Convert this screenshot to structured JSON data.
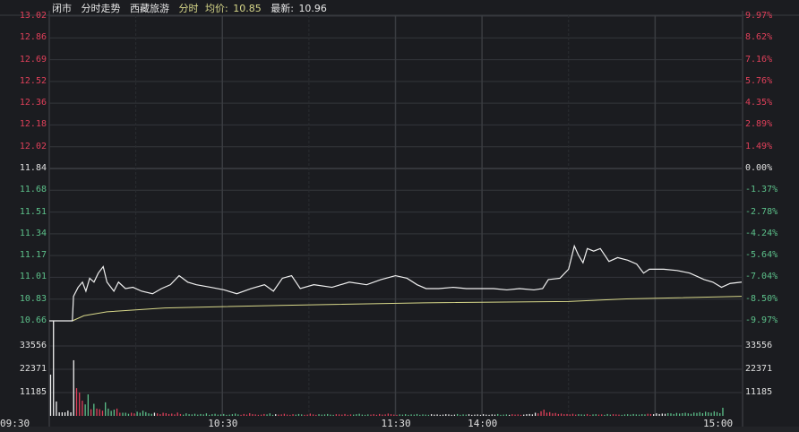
{
  "header": {
    "status": "闭市",
    "mode": "分时走势",
    "stock_name": "西藏旅游",
    "chart_label": "分时",
    "avg_label": "均价:",
    "avg_value": "10.85",
    "latest_label": "最新:",
    "latest_value": "10.96"
  },
  "colors": {
    "up": "#e0405a",
    "down": "#5cc08a",
    "price_line": "#f0f0f0",
    "avg_line": "#d8d88a",
    "grid": "#34363b"
  },
  "price_axis": {
    "labels": [
      "13.02",
      "12.86",
      "12.69",
      "12.52",
      "12.36",
      "12.18",
      "12.02",
      "11.84",
      "11.68",
      "11.51",
      "11.34",
      "11.17",
      "11.01",
      "10.83",
      "10.66"
    ],
    "pct": [
      "9.97%",
      "8.62%",
      "7.16%",
      "5.76%",
      "4.35%",
      "2.89%",
      "1.49%",
      "0.00%",
      "-1.37%",
      "-2.78%",
      "-4.24%",
      "-5.64%",
      "-7.04%",
      "-8.50%",
      "-9.97%"
    ],
    "max": 13.02,
    "min": 10.66,
    "prev_close": 11.84
  },
  "volume_axis": {
    "labels": [
      "33556",
      "22371",
      "11185"
    ],
    "values": [
      33556,
      22371,
      11185
    ]
  },
  "time_axis": [
    "09:30",
    "10:30",
    "11:30",
    "14:00",
    "15:00"
  ],
  "chart_data": {
    "type": "line",
    "minutes_total": 240,
    "price": [
      [
        0,
        10.66
      ],
      [
        8,
        10.66
      ],
      [
        8.4,
        10.85
      ],
      [
        10,
        10.92
      ],
      [
        11.5,
        10.96
      ],
      [
        12.7,
        10.89
      ],
      [
        14,
        10.99
      ],
      [
        15.5,
        10.96
      ],
      [
        17,
        11.03
      ],
      [
        18.7,
        11.08
      ],
      [
        20,
        10.96
      ],
      [
        22.4,
        10.89
      ],
      [
        24,
        10.96
      ],
      [
        26.4,
        10.91
      ],
      [
        29,
        10.92
      ],
      [
        32,
        10.89
      ],
      [
        35.8,
        10.87
      ],
      [
        38.9,
        10.91
      ],
      [
        42,
        10.94
      ],
      [
        45,
        11.01
      ],
      [
        48,
        10.96
      ],
      [
        51,
        10.94
      ],
      [
        56,
        10.92
      ],
      [
        60.6,
        10.9
      ],
      [
        65,
        10.87
      ],
      [
        70,
        10.91
      ],
      [
        74.6,
        10.94
      ],
      [
        77.7,
        10.89
      ],
      [
        80.8,
        10.99
      ],
      [
        84,
        11.01
      ],
      [
        87,
        10.91
      ],
      [
        91.7,
        10.94
      ],
      [
        98,
        10.92
      ],
      [
        104,
        10.96
      ],
      [
        110,
        10.94
      ],
      [
        115,
        10.98
      ],
      [
        120,
        11.01
      ],
      [
        124,
        10.99
      ],
      [
        127.5,
        10.94
      ],
      [
        130.6,
        10.91
      ],
      [
        135,
        10.91
      ],
      [
        140,
        10.92
      ],
      [
        144.6,
        10.91
      ],
      [
        149,
        10.91
      ],
      [
        154,
        10.91
      ],
      [
        158.6,
        10.9
      ],
      [
        163,
        10.91
      ],
      [
        168,
        10.9
      ],
      [
        171,
        10.91
      ],
      [
        173,
        10.98
      ],
      [
        177,
        10.99
      ],
      [
        180,
        11.06
      ],
      [
        182,
        11.24
      ],
      [
        183.4,
        11.17
      ],
      [
        185,
        11.11
      ],
      [
        186.5,
        11.22
      ],
      [
        188.7,
        11.2
      ],
      [
        191,
        11.22
      ],
      [
        194,
        11.12
      ],
      [
        197,
        11.15
      ],
      [
        200.5,
        11.13
      ],
      [
        203.6,
        11.1
      ],
      [
        206,
        11.03
      ],
      [
        208,
        11.06
      ],
      [
        213,
        11.06
      ],
      [
        217.6,
        11.05
      ],
      [
        222,
        11.03
      ],
      [
        227,
        10.98
      ],
      [
        230,
        10.96
      ],
      [
        233,
        10.92
      ],
      [
        236,
        10.95
      ],
      [
        240,
        10.96
      ]
    ],
    "avg": [
      [
        8,
        10.66
      ],
      [
        12,
        10.7
      ],
      [
        20,
        10.73
      ],
      [
        40,
        10.76
      ],
      [
        80,
        10.78
      ],
      [
        130,
        10.8
      ],
      [
        180,
        10.81
      ],
      [
        200,
        10.83
      ],
      [
        240,
        10.85
      ]
    ],
    "volume": [
      19800,
      46000,
      6900,
      1700,
      1700,
      1700,
      2500,
      1700,
      26700,
      13300,
      11200,
      7300,
      5500,
      10300,
      3200,
      5800,
      3500,
      3200,
      2500,
      6500,
      3500,
      2400,
      3000,
      3500,
      1500,
      1500,
      1500,
      1000,
      1500,
      1200,
      2000,
      1500,
      2500,
      1800,
      1200,
      1000,
      1500,
      1200,
      800,
      1500,
      1300,
      900,
      1100,
      700,
      1600,
      900,
      600,
      1200,
      800,
      700,
      1000,
      600,
      900,
      700,
      1200,
      500,
      800,
      1000,
      600,
      700,
      900,
      500,
      600,
      800,
      1100,
      700,
      500,
      900,
      600,
      1300,
      800,
      700,
      500,
      600,
      900,
      700,
      1200,
      500,
      800,
      600,
      700,
      1000,
      600,
      500,
      800,
      600,
      900,
      700,
      500,
      600,
      1100,
      700,
      500,
      800,
      600,
      700,
      900,
      600,
      500,
      800,
      700,
      600,
      900,
      500,
      700,
      600,
      800,
      1000,
      600,
      500,
      700,
      600,
      800,
      500,
      900,
      600,
      700,
      1100,
      800,
      600,
      500,
      700,
      600,
      800,
      500,
      700,
      600,
      900,
      500,
      700,
      600,
      500,
      800,
      600,
      700,
      500,
      600,
      800,
      700,
      500,
      600,
      900,
      500,
      700,
      600,
      800,
      500,
      600,
      700,
      500,
      800,
      600,
      500,
      700,
      600,
      900,
      500,
      600,
      700,
      500,
      800,
      600,
      700,
      500,
      600,
      800,
      900,
      700,
      1500,
      1200,
      2200,
      3000,
      1500,
      1800,
      1200,
      1400,
      900,
      1100,
      800,
      900,
      700,
      1000,
      600,
      800,
      700,
      600,
      900,
      500,
      700,
      800,
      600,
      700,
      500,
      900,
      600,
      800,
      700,
      600,
      500,
      700,
      800,
      600,
      900,
      700,
      600,
      800,
      700,
      1000,
      900,
      800,
      1200,
      900,
      1100,
      1000,
      1300,
      1200,
      900,
      1400,
      1100,
      1300,
      1500,
      1200,
      1000,
      1600,
      1400,
      1800,
      1300,
      2000,
      1700,
      1500,
      2200,
      1800,
      1300,
      3900
    ]
  }
}
